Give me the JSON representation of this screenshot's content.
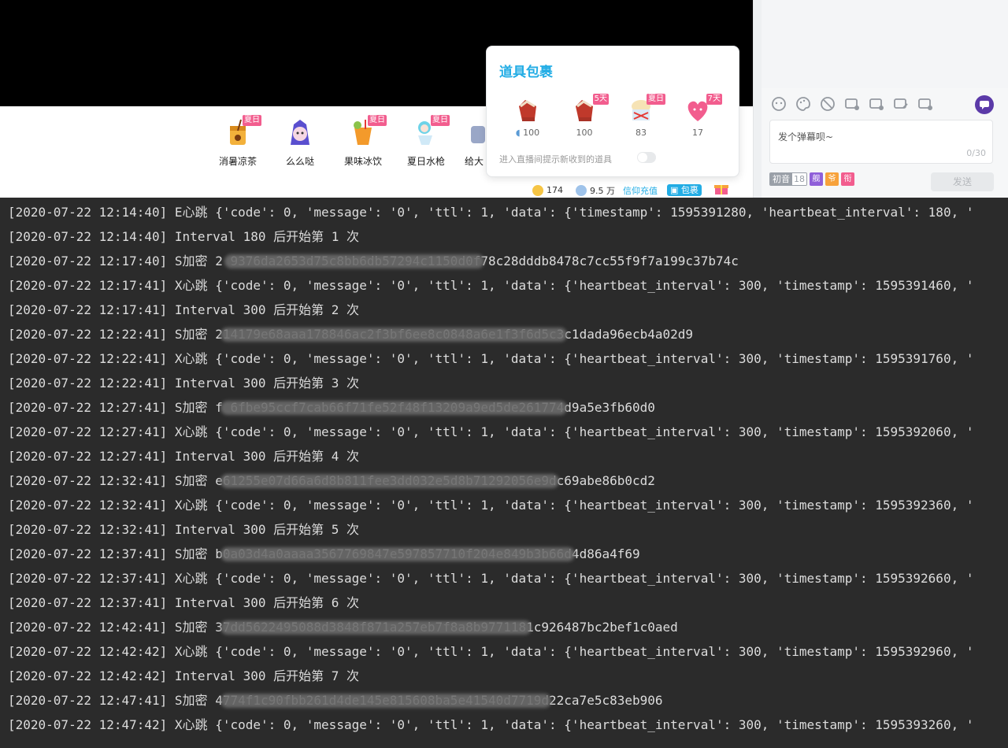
{
  "popup": {
    "title": "道具包裹",
    "items": [
      {
        "name": "gift-item-1",
        "qty": "100",
        "tag": "",
        "icon": "glove"
      },
      {
        "name": "gift-item-2",
        "qty": "100",
        "tag": "5天",
        "icon": "glove"
      },
      {
        "name": "gift-item-3",
        "qty": "83",
        "tag": "夏日",
        "icon": "ice"
      },
      {
        "name": "gift-item-4",
        "qty": "17",
        "tag": "7天",
        "icon": "heart"
      }
    ],
    "hint": "进入直播间提示新收到的道具"
  },
  "gifts": [
    {
      "label": "消暑凉茶",
      "tag": "夏日"
    },
    {
      "label": "么么哒",
      "tag": ""
    },
    {
      "label": "果味冰饮",
      "tag": "夏日"
    },
    {
      "label": "夏日水枪",
      "tag": "夏日"
    },
    {
      "label": "给大",
      "tag": ""
    }
  ],
  "wallet": {
    "gold": "174",
    "silver": "9.5 万",
    "recharge_label": "信仰充值",
    "package_label": "包裹"
  },
  "chat": {
    "placeholder": "发个弹幕呗~",
    "counter": "0/30",
    "send_label": "发送",
    "fan_badge_name": "初音",
    "fan_badge_level": "18",
    "badge_a": "舰",
    "badge_b": "爷",
    "badge_c": "衔"
  },
  "colors": {
    "accent": "#23ade5",
    "tag_pink": "#f25d8e",
    "terminal_bg": "#2b2b2b",
    "terminal_text": "#dcdcdc"
  },
  "log_lines": [
    {
      "text": "[2020-07-22 12:14:40] E心跳 {'code': 0, 'message': '0', 'ttl': 1, 'data': {'timestamp': 1595391280, 'heartbeat_interval': 180, '"
    },
    {
      "text": "[2020-07-22 12:14:40] Interval 180 后开始第 1 次"
    },
    {
      "text": "[2020-07-22 12:17:40] S加密 2                                   9376da2653d75c8bb6db57294c1150d0f78c28dddb8478c7cc55f9f7a199c37b74c"
    },
    {
      "text": "[2020-07-22 12:17:41] X心跳 {'code': 0, 'message': '0', 'ttl': 1, 'data': {'heartbeat_interval': 300, 'timestamp': 1595391460, '"
    },
    {
      "text": "[2020-07-22 12:17:41] Interval 300 后开始第 2 次"
    },
    {
      "text": "[2020-07-22 12:22:41] S加密                                       214179e68aaa178846ac2f3bf6ee8c0848a6e1f3f6d5c3c1dada96ecb4a02d9"
    },
    {
      "text": "[2020-07-22 12:22:41] X心跳 {'code': 0, 'message': '0', 'ttl': 1, 'data': {'heartbeat_interval': 300, 'timestamp': 1595391760, '"
    },
    {
      "text": "[2020-07-22 12:22:41] Interval 300 后开始第 3 次"
    },
    {
      "text": "[2020-07-22 12:27:41] S加密 f                                      6fbe95ccf7cab66f71fe52f48f13209a9ed5de261774d9a5e3fb60d0"
    },
    {
      "text": "[2020-07-22 12:27:41] X心跳 {'code': 0, 'message': '0', 'ttl': 1, 'data': {'heartbeat_interval': 300, 'timestamp': 1595392060, '"
    },
    {
      "text": "[2020-07-22 12:27:41] Interval 300 后开始第 4 次"
    },
    {
      "text": "[2020-07-22 12:32:41] S加密                                       e61255e07d66a6d8b811fee3dd032e5d8b71292056e9dc69abe86b0cd2"
    },
    {
      "text": "[2020-07-22 12:32:41] X心跳 {'code': 0, 'message': '0', 'ttl': 1, 'data': {'heartbeat_interval': 300, 'timestamp': 1595392360, '"
    },
    {
      "text": "[2020-07-22 12:32:41] Interval 300 后开始第 5 次"
    },
    {
      "text": "[2020-07-22 12:37:41] S加密                                       b0a03d4a0aaaa3567769847e597857710f204e849b3b66d4d86a4f69"
    },
    {
      "text": "[2020-07-22 12:37:41] X心跳 {'code': 0, 'message': '0', 'ttl': 1, 'data': {'heartbeat_interval': 300, 'timestamp': 1595392660, '"
    },
    {
      "text": "[2020-07-22 12:37:41] Interval 300 后开始第 6 次"
    },
    {
      "text": "[2020-07-22 12:42:41] S加密                                      37dd5622495088d3848f871a257eb7f8a8b9771181c926487bc2bef1c0aed"
    },
    {
      "text": "[2020-07-22 12:42:42] X心跳 {'code': 0, 'message': '0', 'ttl': 1, 'data': {'heartbeat_interval': 300, 'timestamp': 1595392960, '"
    },
    {
      "text": "[2020-07-22 12:42:42] Interval 300 后开始第 7 次"
    },
    {
      "text": "[2020-07-22 12:47:41] S加密                                        4774f1c90fbb261d4de145e815608ba5e41540d7719d22ca7e5c83eb906"
    },
    {
      "text": "[2020-07-22 12:47:42] X心跳 {'code': 0, 'message': '0', 'ttl': 1, 'data': {'heartbeat_interval': 300, 'timestamp': 1595393260, '"
    }
  ]
}
